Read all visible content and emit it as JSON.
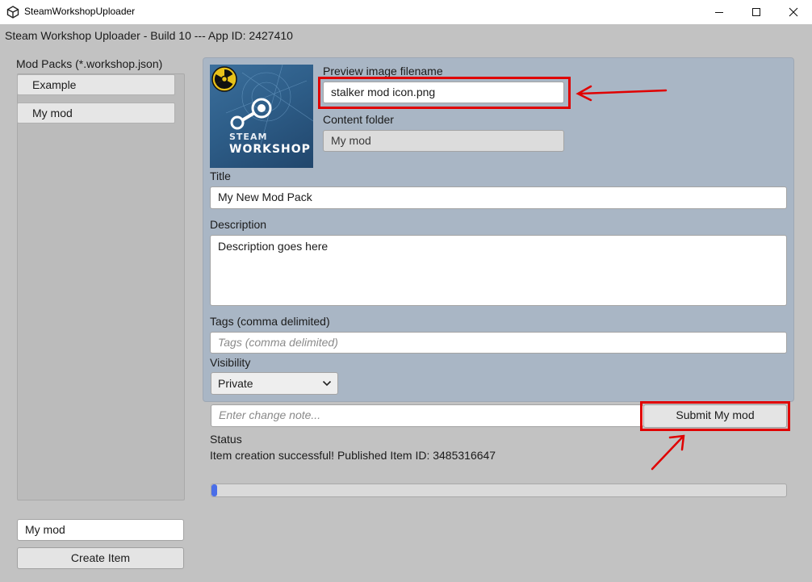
{
  "window": {
    "title": "SteamWorkshopUploader",
    "icons": {
      "app": "unity-logo-icon",
      "minimize": "minimize-icon",
      "maximize": "maximize-icon",
      "close": "close-icon"
    }
  },
  "header": {
    "text": "Steam Workshop Uploader - Build 10 --- App ID: 2427410"
  },
  "sidebar": {
    "label": "Mod Packs (*.workshop.json)",
    "items": [
      {
        "label": "Example"
      },
      {
        "label": "My mod"
      }
    ],
    "new_mod_value": "My mod",
    "create_label": "Create Item"
  },
  "preview": {
    "image": {
      "brand_line1": "STEAM",
      "brand_line2": "WORKSHOP",
      "icons": [
        "radiation-icon",
        "steam-logo-icon"
      ]
    },
    "label": "Preview image filename",
    "value": "stalker mod icon.png"
  },
  "content_folder": {
    "label": "Content folder",
    "value": "My mod"
  },
  "title_field": {
    "label": "Title",
    "value": "My New Mod Pack"
  },
  "description_field": {
    "label": "Description",
    "value": "Description goes here"
  },
  "tags_field": {
    "label": "Tags (comma delimited)",
    "placeholder": "Tags (comma delimited)"
  },
  "visibility": {
    "label": "Visibility",
    "selected": "Private"
  },
  "change_note": {
    "placeholder": "Enter change note..."
  },
  "submit": {
    "label": "Submit My mod"
  },
  "status": {
    "label": "Status",
    "text": "Item creation successful! Published Item ID: 3485316647"
  },
  "progress": {
    "fraction": 0.01
  },
  "colors": {
    "highlight": "#e00000",
    "panel": "#a9b6c5",
    "progress": "#4a6ee8",
    "background": "#c2c2c2"
  }
}
